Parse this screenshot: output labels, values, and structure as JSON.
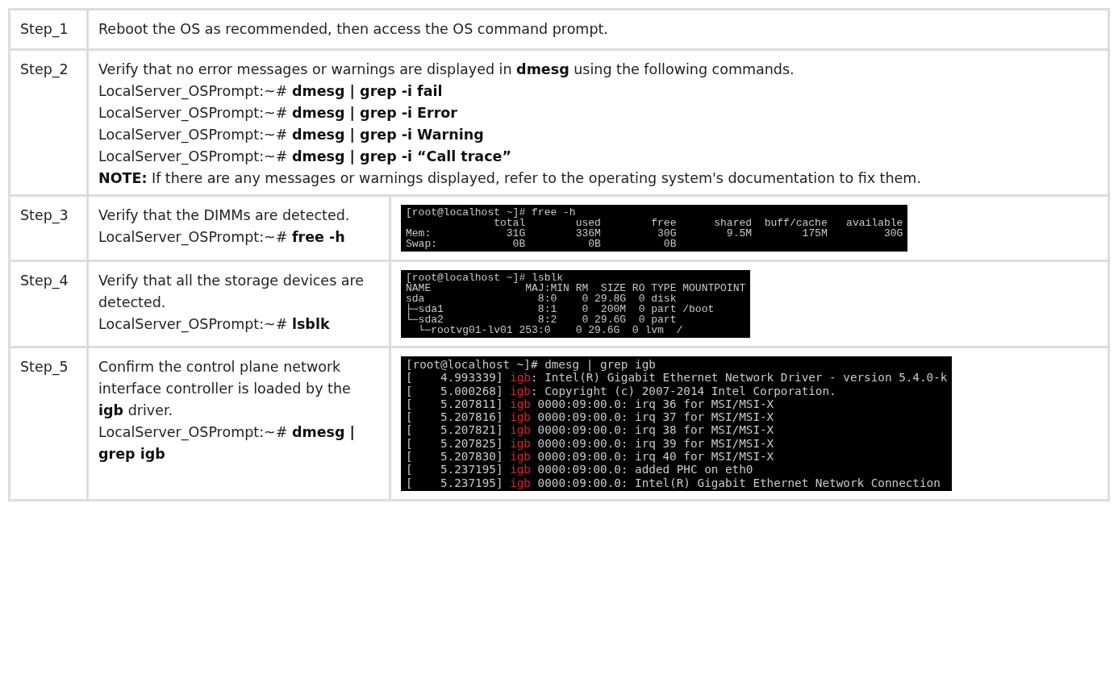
{
  "rows": [
    {
      "step": "Step_1",
      "kind": "full",
      "lines": [
        "Reboot the OS as recommended, then access the OS command prompt."
      ]
    },
    {
      "step": "Step_2",
      "kind": "full",
      "lines": [
        "Verify that no error messages or warnings are displayed in **dmesg** using the following commands.",
        "LocalServer_OSPrompt:~# **dmesg | grep -i fail**",
        "LocalServer_OSPrompt:~# **dmesg | grep -i Error**",
        "LocalServer_OSPrompt:~# **dmesg | grep -i Warning**",
        "LocalServer_OSPrompt:~# **dmesg | grep -i “Call trace”**",
        "**NOTE:** If there are any messages or warnings displayed, refer to the operating system's documentation to fix them."
      ]
    },
    {
      "step": "Step_3",
      "kind": "split",
      "lines": [
        "Verify that the DIMMs are detected.",
        "LocalServer_OSPrompt:~# **free -h**"
      ],
      "terminal": {
        "kind": "table",
        "lines": [
          [
            {
              "text": "[root@localhost ~]# free -h",
              "highlight": false
            }
          ],
          [
            {
              "text": "              total        used        free      shared  buff/cache   available",
              "highlight": false
            }
          ],
          [
            {
              "text": "Mem:            31G        336M         30G        9.5M        175M         30G",
              "highlight": false
            }
          ],
          [
            {
              "text": "Swap:            0B          0B          0B",
              "highlight": false
            }
          ]
        ]
      }
    },
    {
      "step": "Step_4",
      "kind": "split",
      "lines": [
        "Verify that all the storage devices are detected.",
        "LocalServer_OSPrompt:~# **lsblk**"
      ],
      "terminal": {
        "kind": "table",
        "lines": [
          [
            {
              "text": "[root@localhost ~]# lsblk",
              "highlight": false
            }
          ],
          [
            {
              "text": "NAME               MAJ:MIN RM  SIZE RO TYPE MOUNTPOINT",
              "highlight": false
            }
          ],
          [
            {
              "text": "sda                  8:0    0 29.8G  0 disk",
              "highlight": false
            }
          ],
          [
            {
              "text": "├─sda1               8:1    0  200M  0 part /boot",
              "highlight": false
            }
          ],
          [
            {
              "text": "└─sda2               8:2    0 29.6G  0 part",
              "highlight": false
            }
          ],
          [
            {
              "text": "  └─rootvg01-lv01 253:0    0 29.6G  0 lvm  /",
              "highlight": false
            }
          ]
        ]
      }
    },
    {
      "step": "Step_5",
      "kind": "split",
      "lines": [
        "Confirm the control plane network interface controller is loaded by the **igb** driver.",
        "LocalServer_OSPrompt:~# **dmesg | grep igb**"
      ],
      "terminal": {
        "kind": "log",
        "lines": [
          [
            {
              "text": "[root@localhost ~]# dmesg | grep igb",
              "highlight": false
            }
          ],
          [
            {
              "text": "[    4.993339] ",
              "highlight": false
            },
            {
              "text": "igb",
              "highlight": true
            },
            {
              "text": ": Intel(R) Gigabit Ethernet Network Driver - version 5.4.0-k",
              "highlight": false
            }
          ],
          [
            {
              "text": "[    5.000268] ",
              "highlight": false
            },
            {
              "text": "igb",
              "highlight": true
            },
            {
              "text": ": Copyright (c) 2007-2014 Intel Corporation.",
              "highlight": false
            }
          ],
          [
            {
              "text": "[    5.207811] ",
              "highlight": false
            },
            {
              "text": "igb",
              "highlight": true
            },
            {
              "text": " 0000:09:00.0: irq 36 for MSI/MSI-X",
              "highlight": false
            }
          ],
          [
            {
              "text": "[    5.207816] ",
              "highlight": false
            },
            {
              "text": "igb",
              "highlight": true
            },
            {
              "text": " 0000:09:00.0: irq 37 for MSI/MSI-X",
              "highlight": false
            }
          ],
          [
            {
              "text": "[    5.207821] ",
              "highlight": false
            },
            {
              "text": "igb",
              "highlight": true
            },
            {
              "text": " 0000:09:00.0: irq 38 for MSI/MSI-X",
              "highlight": false
            }
          ],
          [
            {
              "text": "[    5.207825] ",
              "highlight": false
            },
            {
              "text": "igb",
              "highlight": true
            },
            {
              "text": " 0000:09:00.0: irq 39 for MSI/MSI-X",
              "highlight": false
            }
          ],
          [
            {
              "text": "[    5.207830] ",
              "highlight": false
            },
            {
              "text": "igb",
              "highlight": true
            },
            {
              "text": " 0000:09:00.0: irq 40 for MSI/MSI-X",
              "highlight": false
            }
          ],
          [
            {
              "text": "[    5.237195] ",
              "highlight": false
            },
            {
              "text": "igb",
              "highlight": true
            },
            {
              "text": " 0000:09:00.0: added PHC on eth0",
              "highlight": false
            }
          ],
          [
            {
              "text": "[    5.237195] ",
              "highlight": false
            },
            {
              "text": "igb",
              "highlight": true
            },
            {
              "text": " 0000:09:00.0: Intel(R) Gigabit Ethernet Network Connection",
              "highlight": false
            }
          ]
        ]
      }
    }
  ]
}
